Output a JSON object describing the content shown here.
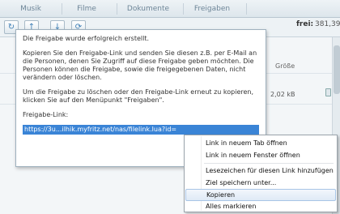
{
  "nav": {
    "tabs": [
      "Musik",
      "Filme",
      "Dokumente",
      "Freigaben"
    ]
  },
  "toolbar": {
    "buttons": [
      "refresh-icon",
      "arrow-up-icon",
      "arrow-down-icon",
      "share-icon"
    ],
    "free_label": "frei:",
    "free_value": "381,39"
  },
  "table": {
    "size_header": "Größe",
    "rows": [
      {
        "size": "2,02 kB"
      }
    ]
  },
  "dialog": {
    "paragraph1": "Die Freigabe wurde erfolgreich erstellt.",
    "paragraph2": "Kopieren Sie den Freigabe-Link und senden Sie diesen z.B. per E-Mail an die Personen, denen Sie Zugriff auf diese Freigabe geben möchten. Die Personen können die Freigabe, sowie die freigegebenen Daten, nicht verändern oder löschen.",
    "paragraph3": "Um die Freigabe zu löschen oder den Freigabe-Link erneut zu kopieren, klicken Sie auf den Menüpunkt \"Freigaben\".",
    "link_label": "Freigabe-Link:",
    "link_value": "https://3u...ilhik.myfritz.net/nas/filelink.lua?id="
  },
  "context_menu": {
    "items": [
      "Link in neuem Tab öffnen",
      "Link in neuem Fenster öffnen",
      "Lesezeichen für diesen Link hinzufügen",
      "Ziel speichern unter...",
      "Kopieren",
      "Alles markieren"
    ],
    "highlighted": "Kopieren"
  },
  "colors": {
    "selection": "#3a84d6",
    "nav_text": "#6e8698"
  }
}
